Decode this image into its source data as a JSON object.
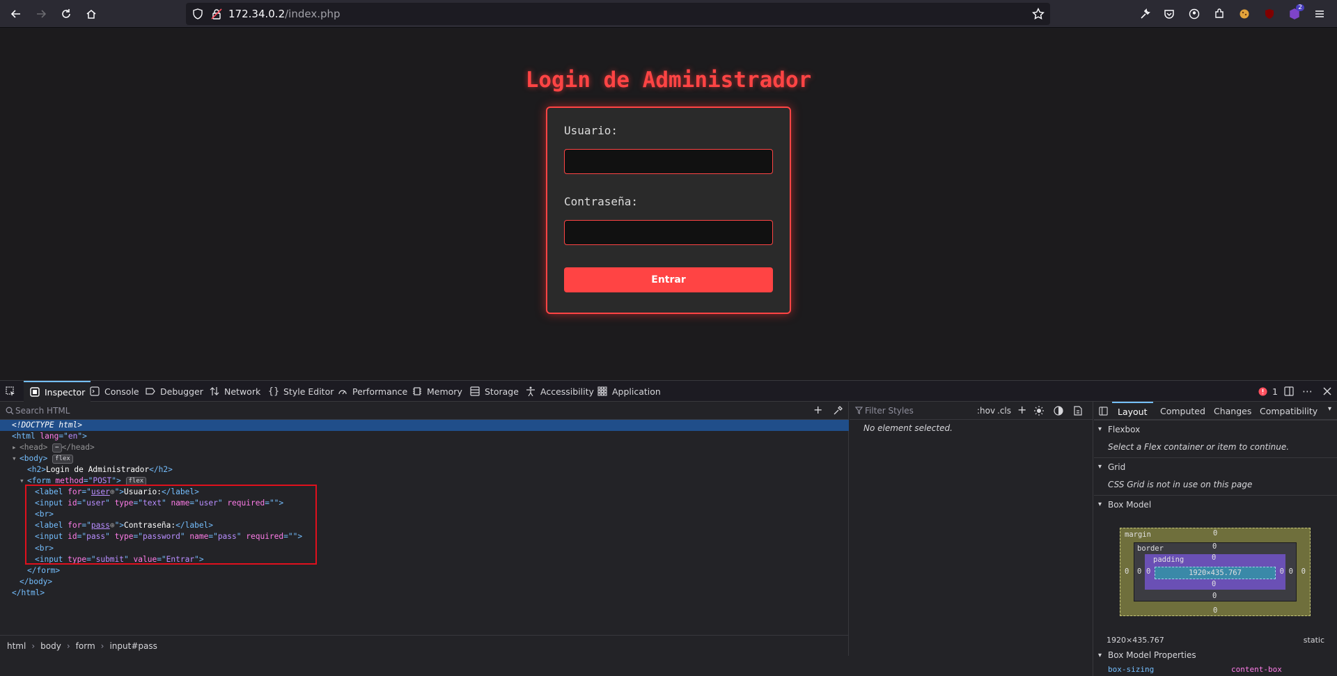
{
  "browser": {
    "url_host": "172.34.0.2",
    "url_path": "/index.php",
    "ext_badge": "2"
  },
  "page": {
    "title": "Login de Administrador",
    "user_label": "Usuario:",
    "pass_label": "Contraseña:",
    "submit_label": "Entrar"
  },
  "devtools": {
    "tabs": [
      "Inspector",
      "Console",
      "Debugger",
      "Network",
      "Style Editor",
      "Performance",
      "Memory",
      "Storage",
      "Accessibility",
      "Application"
    ],
    "error_count": "1",
    "search_placeholder": "Search HTML",
    "filter_placeholder": "Filter Styles",
    "hov": ":hov",
    "cls": ".cls",
    "no_element": "No element selected.",
    "breadcrumbs": [
      "html",
      "body",
      "form",
      "input#pass"
    ],
    "layout_tabs": [
      "Layout",
      "Computed",
      "Changes",
      "Compatibility"
    ],
    "flexbox_title": "Flexbox",
    "flexbox_note": "Select a Flex container or item to continue.",
    "grid_title": "Grid",
    "grid_note": "CSS Grid is not in use on this page",
    "boxmodel_title": "Box Model",
    "bm_margin": "margin",
    "bm_border": "border",
    "bm_padding": "padding",
    "bm_zero": "0",
    "bm_size": "1920×435.767",
    "bm_dims": "1920×435.767",
    "bm_position": "static",
    "bmprops_title": "Box Model Properties",
    "prop_name": "box-sizing",
    "prop_value": "content-box",
    "flex_badge": "flex",
    "code": {
      "doctype": "<!DOCTYPE html>",
      "html_open": "<html lang=\"en\">",
      "head": "<head>",
      "head_close": "</head>",
      "body_open": "<body>",
      "h2": "Login de Administrador",
      "form_method": "POST",
      "label_user_text": "Usuario:",
      "label_pass_text": "Contraseña:",
      "input_user_id": "user",
      "input_pass_id": "pass",
      "input_type_text": "text",
      "input_type_password": "password",
      "input_type_submit": "submit",
      "submit_value": "Entrar"
    }
  }
}
